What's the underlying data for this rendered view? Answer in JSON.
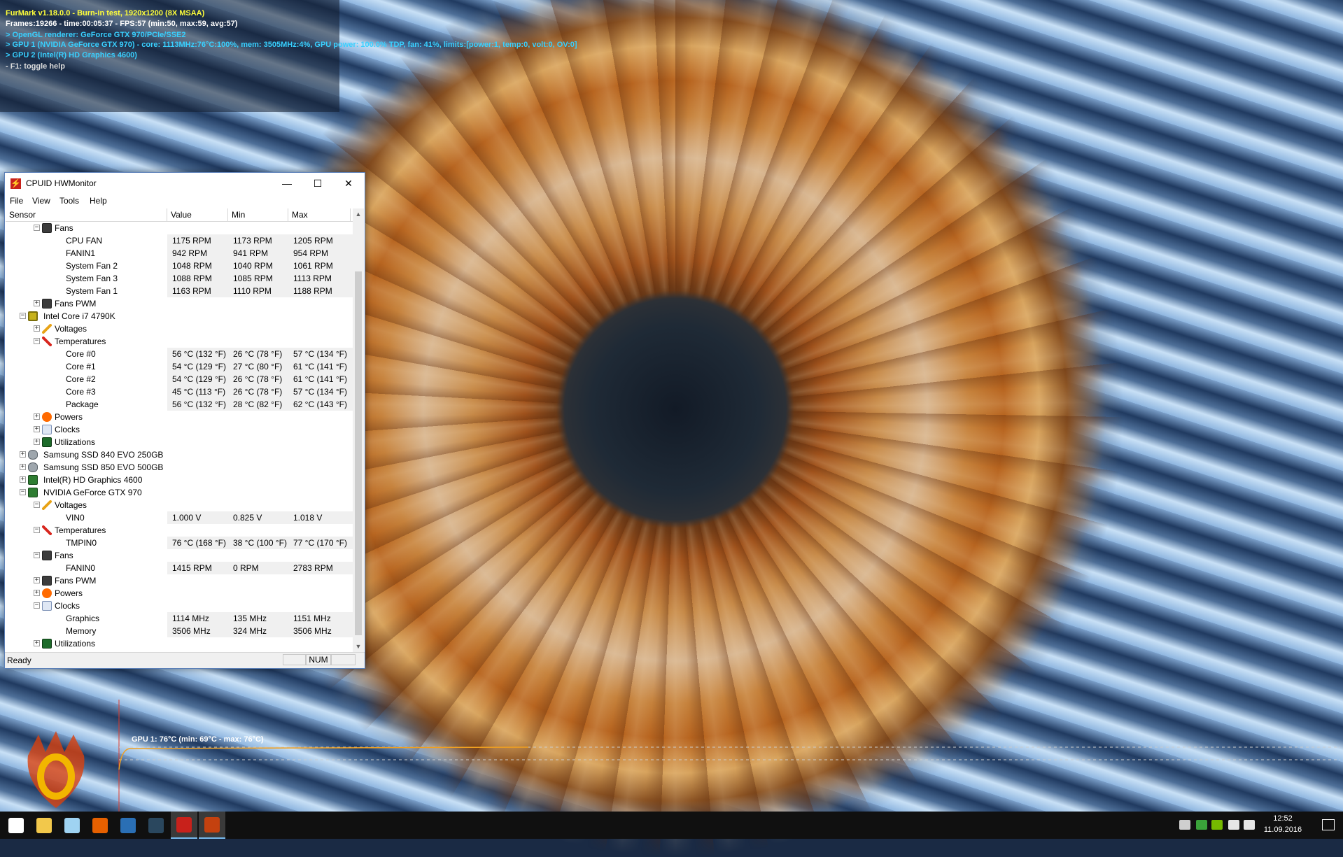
{
  "furmark": {
    "line1": "FurMark v1.18.0.0 - Burn-in test, 1920x1200 (8X MSAA)",
    "line2": "Frames:19266 - time:00:05:37 - FPS:57 (min:50, max:59, avg:57)",
    "line3": "> OpenGL renderer: GeForce GTX 970/PCIe/SSE2",
    "line4": "> GPU 1 (NVIDIA GeForce GTX 970) - core: 1113MHz:76°C:100%, mem: 3505MHz:4%, GPU power: 100.0% TDP, fan: 41%, limits:[power:1, temp:0, volt:0, OV:0]",
    "line5": "> GPU 2 (Intel(R) HD Graphics 4600)",
    "line6": "- F1: toggle help",
    "graph_label": "GPU 1: 76°C (min: 69°C - max: 76°C)"
  },
  "window": {
    "title": "CPUID HWMonitor",
    "min_glyph": "—",
    "max_glyph": "☐",
    "close_glyph": "✕"
  },
  "menu": {
    "file": "File",
    "view": "View",
    "tools": "Tools",
    "help": "Help"
  },
  "columns": {
    "sensor": "Sensor",
    "value": "Value",
    "min": "Min",
    "max": "Max"
  },
  "rows": [
    {
      "level": 2,
      "exp": "−",
      "icon": "fan",
      "label": "Fans"
    },
    {
      "level": 4,
      "label": "CPU FAN",
      "value": "1175 RPM",
      "min": "1173 RPM",
      "max": "1205 RPM"
    },
    {
      "level": 4,
      "label": "FANIN1",
      "value": "942 RPM",
      "min": "941 RPM",
      "max": "954 RPM"
    },
    {
      "level": 4,
      "label": "System Fan 2",
      "value": "1048 RPM",
      "min": "1040 RPM",
      "max": "1061 RPM"
    },
    {
      "level": 4,
      "label": "System Fan 3",
      "value": "1088 RPM",
      "min": "1085 RPM",
      "max": "1113 RPM"
    },
    {
      "level": 4,
      "label": "System Fan 1",
      "value": "1163 RPM",
      "min": "1110 RPM",
      "max": "1188 RPM"
    },
    {
      "level": 2,
      "exp": "+",
      "icon": "fan",
      "label": "Fans PWM"
    },
    {
      "level": 1,
      "exp": "−",
      "icon": "chip",
      "label": "Intel Core i7 4790K"
    },
    {
      "level": 2,
      "exp": "+",
      "icon": "volt",
      "label": "Voltages"
    },
    {
      "level": 2,
      "exp": "−",
      "icon": "temp",
      "label": "Temperatures"
    },
    {
      "level": 4,
      "label": "Core #0",
      "value": "56 °C  (132 °F)",
      "min": "26 °C  (78 °F)",
      "max": "57 °C  (134 °F)"
    },
    {
      "level": 4,
      "label": "Core #1",
      "value": "54 °C  (129 °F)",
      "min": "27 °C  (80 °F)",
      "max": "61 °C  (141 °F)"
    },
    {
      "level": 4,
      "label": "Core #2",
      "value": "54 °C  (129 °F)",
      "min": "26 °C  (78 °F)",
      "max": "61 °C  (141 °F)"
    },
    {
      "level": 4,
      "label": "Core #3",
      "value": "45 °C  (113 °F)",
      "min": "26 °C  (78 °F)",
      "max": "57 °C  (134 °F)"
    },
    {
      "level": 4,
      "label": "Package",
      "value": "56 °C  (132 °F)",
      "min": "28 °C  (82 °F)",
      "max": "62 °C  (143 °F)"
    },
    {
      "level": 2,
      "exp": "+",
      "icon": "power",
      "label": "Powers"
    },
    {
      "level": 2,
      "exp": "+",
      "icon": "clock",
      "label": "Clocks"
    },
    {
      "level": 2,
      "exp": "+",
      "icon": "util",
      "label": "Utilizations"
    },
    {
      "level": 1,
      "exp": "+",
      "icon": "disk",
      "label": "Samsung SSD 840 EVO 250GB"
    },
    {
      "level": 1,
      "exp": "+",
      "icon": "disk",
      "label": "Samsung SSD 850 EVO 500GB"
    },
    {
      "level": 1,
      "exp": "+",
      "icon": "gpu",
      "label": "Intel(R) HD Graphics 4600"
    },
    {
      "level": 1,
      "exp": "−",
      "icon": "gpu",
      "label": "NVIDIA GeForce GTX 970"
    },
    {
      "level": 2,
      "exp": "−",
      "icon": "volt",
      "label": "Voltages"
    },
    {
      "level": 4,
      "label": "VIN0",
      "value": "1.000 V",
      "min": "0.825 V",
      "max": "1.018 V"
    },
    {
      "level": 2,
      "exp": "−",
      "icon": "temp",
      "label": "Temperatures"
    },
    {
      "level": 4,
      "label": "TMPIN0",
      "value": "76 °C  (168 °F)",
      "min": "38 °C  (100 °F)",
      "max": "77 °C  (170 °F)"
    },
    {
      "level": 2,
      "exp": "−",
      "icon": "fan",
      "label": "Fans"
    },
    {
      "level": 4,
      "label": "FANIN0",
      "value": "1415 RPM",
      "min": "0 RPM",
      "max": "2783 RPM"
    },
    {
      "level": 2,
      "exp": "+",
      "icon": "fan",
      "label": "Fans PWM"
    },
    {
      "level": 2,
      "exp": "+",
      "icon": "power",
      "label": "Powers"
    },
    {
      "level": 2,
      "exp": "−",
      "icon": "clock",
      "label": "Clocks"
    },
    {
      "level": 4,
      "label": "Graphics",
      "value": "1114 MHz",
      "min": "135 MHz",
      "max": "1151 MHz"
    },
    {
      "level": 4,
      "label": "Memory",
      "value": "3506 MHz",
      "min": "324 MHz",
      "max": "3506 MHz"
    },
    {
      "level": 2,
      "exp": "+",
      "icon": "util",
      "label": "Utilizations"
    }
  ],
  "status": {
    "text": "Ready",
    "num": "NUM"
  },
  "taskbar": {
    "apps": [
      {
        "name": "start",
        "color": "#ffffff"
      },
      {
        "name": "file-explorer",
        "color": "#f2c84b"
      },
      {
        "name": "notepad",
        "color": "#9fd3f2"
      },
      {
        "name": "firefox",
        "color": "#e66000"
      },
      {
        "name": "thunderbird",
        "color": "#2a6fb5"
      },
      {
        "name": "steam",
        "color": "#2a475e"
      },
      {
        "name": "hwmonitor",
        "color": "#c8211b",
        "active": true
      },
      {
        "name": "furmark",
        "color": "#c4410f",
        "active": true
      }
    ],
    "time": "12:52",
    "date": "11.09.2016"
  }
}
